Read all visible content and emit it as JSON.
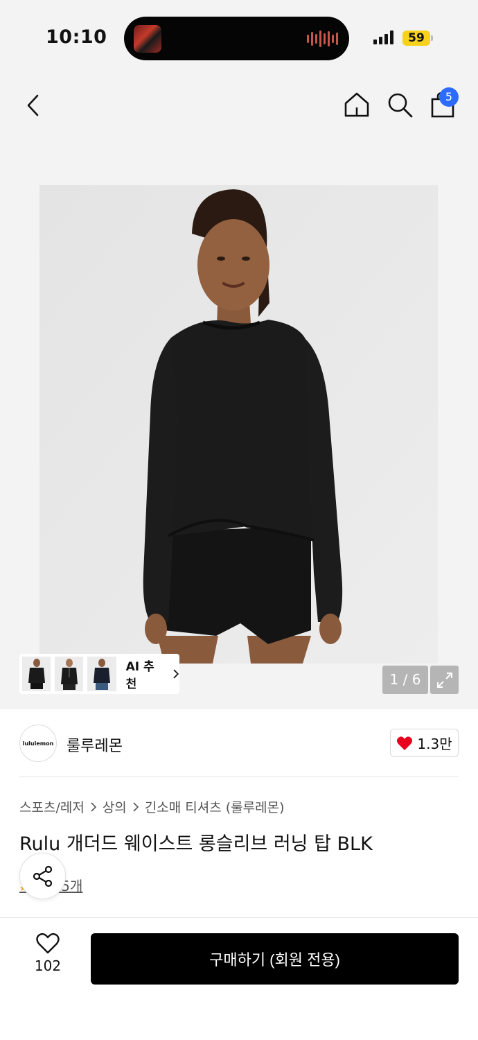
{
  "status_bar": {
    "time": "10:10",
    "battery": "59",
    "battery_color": "#f6d21b"
  },
  "header": {
    "icons": [
      "back-icon",
      "home-icon",
      "search-icon",
      "shopping-bag-icon"
    ],
    "cart_count": "5",
    "badge_color": "#2d6bff"
  },
  "gallery": {
    "ai_label": "AI 추천",
    "page_counter": "1 / 6"
  },
  "brand": {
    "logo_text": "lululemon",
    "name": "룰루레몬",
    "like_count": "1.3만",
    "like_color": "#e8001c"
  },
  "breadcrumb": [
    "스포츠/레저",
    "상의",
    "긴소매 티셔츠 (룰루레몬)"
  ],
  "product": {
    "title": "Rulu 개더드 웨이스트 롱슬리브 러닝 탑 BLK",
    "review_text": "후기 5개"
  },
  "bottom_bar": {
    "wish_count": "102",
    "buy_label": "구매하기 (회원 전용)"
  }
}
